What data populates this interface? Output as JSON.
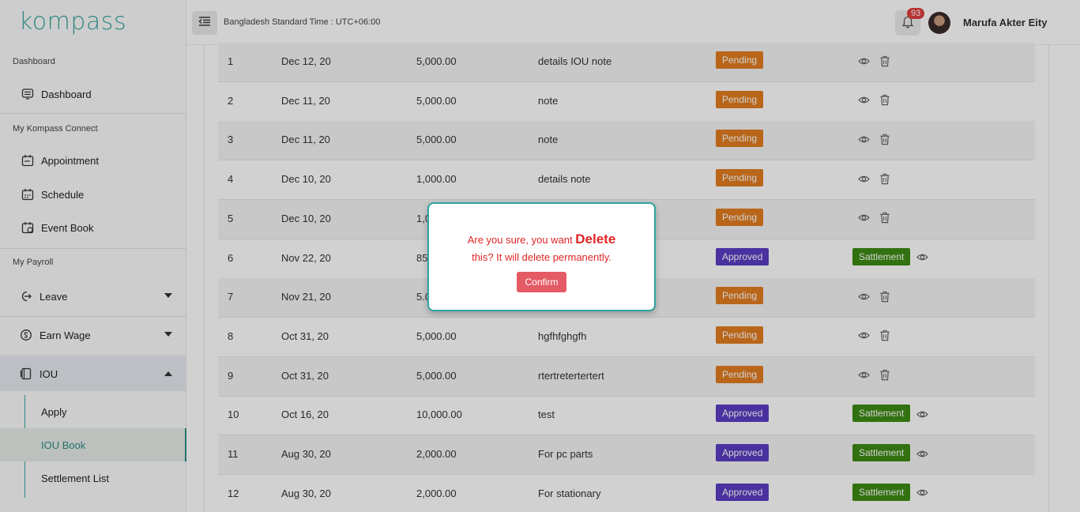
{
  "logo": "kompass",
  "sidebar": {
    "section_dashboard": "Dashboard",
    "dashboard": "Dashboard",
    "section_connect": "My Kompass Connect",
    "appointment": "Appointment",
    "schedule": "Schedule",
    "event_book": "Event Book",
    "section_payroll": "My Payroll",
    "leave": "Leave",
    "earn_wage": "Earn Wage",
    "iou": "IOU",
    "apply": "Apply",
    "iou_book": "IOU Book",
    "settlement_list": "Settlement List"
  },
  "header": {
    "timezone": "Bangladesh Standard Time : UTC+06:00",
    "notifications": "93",
    "user_name": "Marufa Akter Eity"
  },
  "table": {
    "rows": [
      {
        "no": "1",
        "date": "Dec 12, 20",
        "amount": "5,000.00",
        "note": "details IOU note",
        "status": "Pending"
      },
      {
        "no": "2",
        "date": "Dec 11, 20",
        "amount": "5,000.00",
        "note": "note",
        "status": "Pending"
      },
      {
        "no": "3",
        "date": "Dec 11, 20",
        "amount": "5,000.00",
        "note": "note",
        "status": "Pending"
      },
      {
        "no": "4",
        "date": "Dec 10, 20",
        "amount": "1,000.00",
        "note": "details note",
        "status": "Pending"
      },
      {
        "no": "5",
        "date": "Dec 10, 20",
        "amount": "1,0",
        "note": "",
        "status": "Pending"
      },
      {
        "no": "6",
        "date": "Nov 22, 20",
        "amount": "85",
        "note": "",
        "status": "Approved",
        "action": "Sattlement"
      },
      {
        "no": "7",
        "date": "Nov 21, 20",
        "amount": "5.0",
        "note": "",
        "status": "Pending"
      },
      {
        "no": "8",
        "date": "Oct 31, 20",
        "amount": "5,000.00",
        "note": "hgfhfghgfh",
        "status": "Pending"
      },
      {
        "no": "9",
        "date": "Oct 31, 20",
        "amount": "5,000.00",
        "note": "rtertretertertert",
        "status": "Pending"
      },
      {
        "no": "10",
        "date": "Oct 16, 20",
        "amount": "10,000.00",
        "note": "test",
        "status": "Approved",
        "action": "Sattlement"
      },
      {
        "no": "11",
        "date": "Aug 30, 20",
        "amount": "2,000.00",
        "note": "For pc parts",
        "status": "Approved",
        "action": "Sattlement"
      },
      {
        "no": "12",
        "date": "Aug 30, 20",
        "amount": "2,000.00",
        "note": "For stationary",
        "status": "Approved",
        "action": "Sattlement"
      }
    ]
  },
  "modal": {
    "text_before": "Are you sure, you want ",
    "text_emphasis": "Delete",
    "text_after": "this? It will delete permanently.",
    "confirm_label": "Confirm"
  },
  "colors": {
    "accent": "#2ca6a0",
    "pending": "#e27d20",
    "approved": "#5b3cc4",
    "settlement": "#3e8a13",
    "danger_text": "#e12525",
    "confirm": "#e45a65"
  },
  "icons": [
    "menu-collapse-icon",
    "bell-icon",
    "dashboard-icon",
    "appointment-icon",
    "schedule-icon",
    "event-book-icon",
    "leave-icon",
    "earn-wage-icon",
    "iou-icon",
    "eye-icon",
    "trash-icon"
  ]
}
